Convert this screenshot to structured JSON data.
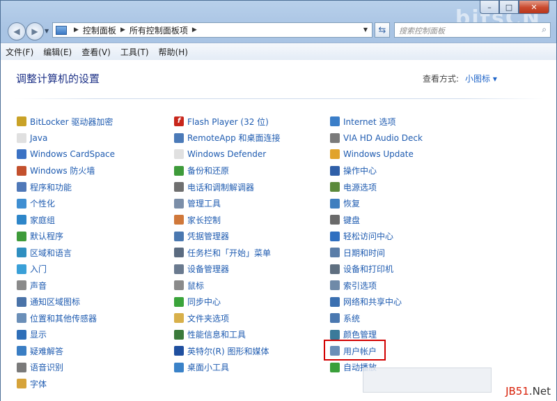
{
  "window": {
    "brand_watermark": "bitsCN",
    "buttons": {
      "minimize": "–",
      "maximize": "□",
      "close": "✕"
    }
  },
  "nav": {
    "back_icon": "back-arrow-icon",
    "forward_icon": "forward-arrow-icon",
    "breadcrumbs": [
      "控制面板",
      "所有控制面板项"
    ],
    "search_placeholder": "搜索控制面板"
  },
  "menu": [
    "文件(F)",
    "编辑(E)",
    "查看(V)",
    "工具(T)",
    "帮助(H)"
  ],
  "content": {
    "heading": "调整计算机的设置",
    "view_by_label": "查看方式:",
    "view_by_value": "小图标 ▾"
  },
  "columns": [
    [
      {
        "label": "BitLocker 驱动器加密",
        "icon": "bitlocker-icon",
        "color": "#c9a227"
      },
      {
        "label": "Java",
        "icon": "java-icon",
        "color": "#e0e0e0"
      },
      {
        "label": "Windows CardSpace",
        "icon": "cardspace-icon",
        "color": "#3b72c4"
      },
      {
        "label": "Windows 防火墙",
        "icon": "firewall-icon",
        "color": "#c3502d"
      },
      {
        "label": "程序和功能",
        "icon": "programs-icon",
        "color": "#4f78b8"
      },
      {
        "label": "个性化",
        "icon": "personalization-icon",
        "color": "#3f8fd2"
      },
      {
        "label": "家庭组",
        "icon": "homegroup-icon",
        "color": "#2e86c9"
      },
      {
        "label": "默认程序",
        "icon": "default-programs-icon",
        "color": "#3e9b3a"
      },
      {
        "label": "区域和语言",
        "icon": "region-icon",
        "color": "#2f8fc0"
      },
      {
        "label": "入门",
        "icon": "getting-started-icon",
        "color": "#3aa0d8"
      },
      {
        "label": "声音",
        "icon": "sound-icon",
        "color": "#8a8a8a"
      },
      {
        "label": "通知区域图标",
        "icon": "notification-icon",
        "color": "#4a73a8"
      },
      {
        "label": "位置和其他传感器",
        "icon": "sensor-icon",
        "color": "#6b8fb8"
      },
      {
        "label": "显示",
        "icon": "display-icon",
        "color": "#2f6fb8"
      },
      {
        "label": "疑难解答",
        "icon": "troubleshoot-icon",
        "color": "#3a7ec4"
      },
      {
        "label": "语音识别",
        "icon": "microphone-icon",
        "color": "#7a7a7a"
      },
      {
        "label": "字体",
        "icon": "fonts-icon",
        "color": "#d6a33a"
      }
    ],
    [
      {
        "label": "Flash Player (32 位)",
        "icon": "flash-icon",
        "color": "#c8261b"
      },
      {
        "label": "RemoteApp 和桌面连接",
        "icon": "remoteapp-icon",
        "color": "#4b7ab8"
      },
      {
        "label": "Windows Defender",
        "icon": "defender-icon",
        "color": "#e0e0e0"
      },
      {
        "label": "备份和还原",
        "icon": "backup-icon",
        "color": "#3e9b3a"
      },
      {
        "label": "电话和调制解调器",
        "icon": "phone-icon",
        "color": "#6f6f6f"
      },
      {
        "label": "管理工具",
        "icon": "admin-tools-icon",
        "color": "#7b8ea8"
      },
      {
        "label": "家长控制",
        "icon": "parental-icon",
        "color": "#d0783a"
      },
      {
        "label": "凭据管理器",
        "icon": "credential-icon",
        "color": "#4a78b0"
      },
      {
        "label": "任务栏和「开始」菜单",
        "icon": "taskbar-icon",
        "color": "#5b6b80"
      },
      {
        "label": "设备管理器",
        "icon": "device-manager-icon",
        "color": "#6a7a8f"
      },
      {
        "label": "鼠标",
        "icon": "mouse-icon",
        "color": "#8a8a8a"
      },
      {
        "label": "同步中心",
        "icon": "sync-icon",
        "color": "#3aa43a"
      },
      {
        "label": "文件夹选项",
        "icon": "folder-options-icon",
        "color": "#d8b04a"
      },
      {
        "label": "性能信息和工具",
        "icon": "performance-icon",
        "color": "#3b7a3b"
      },
      {
        "label": "英特尔(R) 图形和媒体",
        "icon": "intel-graphics-icon",
        "color": "#1f4f9f"
      },
      {
        "label": "桌面小工具",
        "icon": "gadgets-icon",
        "color": "#3a82c8"
      }
    ],
    [
      {
        "label": "Internet 选项",
        "icon": "internet-icon",
        "color": "#3b7ec8"
      },
      {
        "label": "VIA HD Audio Deck",
        "icon": "audio-deck-icon",
        "color": "#7a7a7a"
      },
      {
        "label": "Windows Update",
        "icon": "windows-update-icon",
        "color": "#e1a32a"
      },
      {
        "label": "操作中心",
        "icon": "action-center-icon",
        "color": "#2f5fa8"
      },
      {
        "label": "电源选项",
        "icon": "power-icon",
        "color": "#5b8a3b"
      },
      {
        "label": "恢复",
        "icon": "recovery-icon",
        "color": "#3f7fbf"
      },
      {
        "label": "键盘",
        "icon": "keyboard-icon",
        "color": "#6a6a6a"
      },
      {
        "label": "轻松访问中心",
        "icon": "ease-of-access-icon",
        "color": "#2f6fc0"
      },
      {
        "label": "日期和时间",
        "icon": "clock-icon",
        "color": "#5a7da8"
      },
      {
        "label": "设备和打印机",
        "icon": "printer-icon",
        "color": "#5f6f80"
      },
      {
        "label": "索引选项",
        "icon": "indexing-icon",
        "color": "#6f8aa8"
      },
      {
        "label": "网络和共享中心",
        "icon": "network-icon",
        "color": "#3a6fb0"
      },
      {
        "label": "系统",
        "icon": "system-icon",
        "color": "#4a78b0"
      },
      {
        "label": "颜色管理",
        "icon": "color-management-icon",
        "color": "#3b7a9a"
      },
      {
        "label": "用户帐户",
        "icon": "user-accounts-icon",
        "color": "#6b8fb8"
      },
      {
        "label": "自动播放",
        "icon": "autoplay-icon",
        "color": "#3aa03a"
      }
    ]
  ],
  "watermark": {
    "prefix": "JB51",
    "suffix": ".Net"
  }
}
